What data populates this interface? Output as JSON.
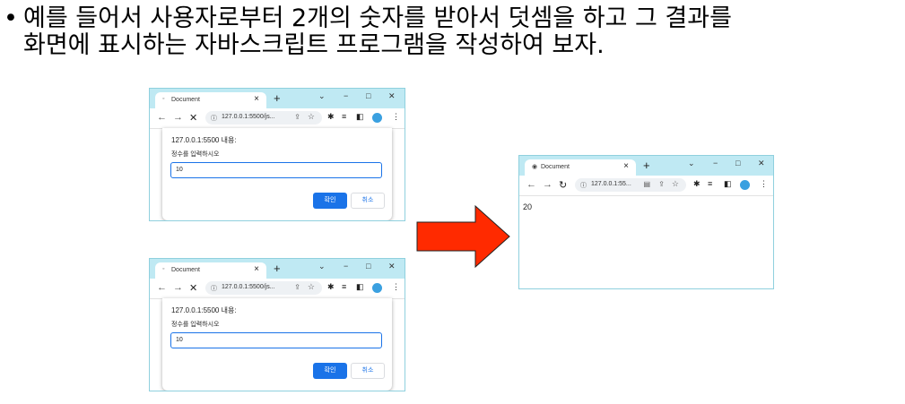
{
  "slide": {
    "bullet": "•",
    "text": "예를 들어서 사용자로부터 2개의 숫자를 받아서 덧셈을 하고 그 결과를\n화면에 표시하는 자바스크립트 프로그램을 작성하여 보자."
  },
  "prompt_window_1": {
    "tab_title": "Document",
    "tab_close": "×",
    "new_tab": "+",
    "url": "127.0.0.1:5500/js...",
    "dialog_origin": "127.0.0.1:5500 내용:",
    "dialog_message": "정수를 입력하시오",
    "input_value": "10",
    "ok_label": "확인",
    "cancel_label": "취소"
  },
  "prompt_window_2": {
    "tab_title": "Document",
    "tab_close": "×",
    "new_tab": "+",
    "url": "127.0.0.1:5500/js...",
    "dialog_origin": "127.0.0.1:5500 내용:",
    "dialog_message": "정수를 입력하시오",
    "input_value": "10",
    "ok_label": "확인",
    "cancel_label": "취소"
  },
  "result_window": {
    "tab_title": "Document",
    "tab_close": "×",
    "new_tab": "+",
    "url": "127.0.0.1:55...",
    "output": "20"
  },
  "colors": {
    "arrow": "#ff2a00",
    "titlebar": "#bfe9f3",
    "ok_button": "#1a73e8"
  },
  "icons": {
    "bullet": "bullet-dot",
    "arrow": "right-arrow"
  }
}
